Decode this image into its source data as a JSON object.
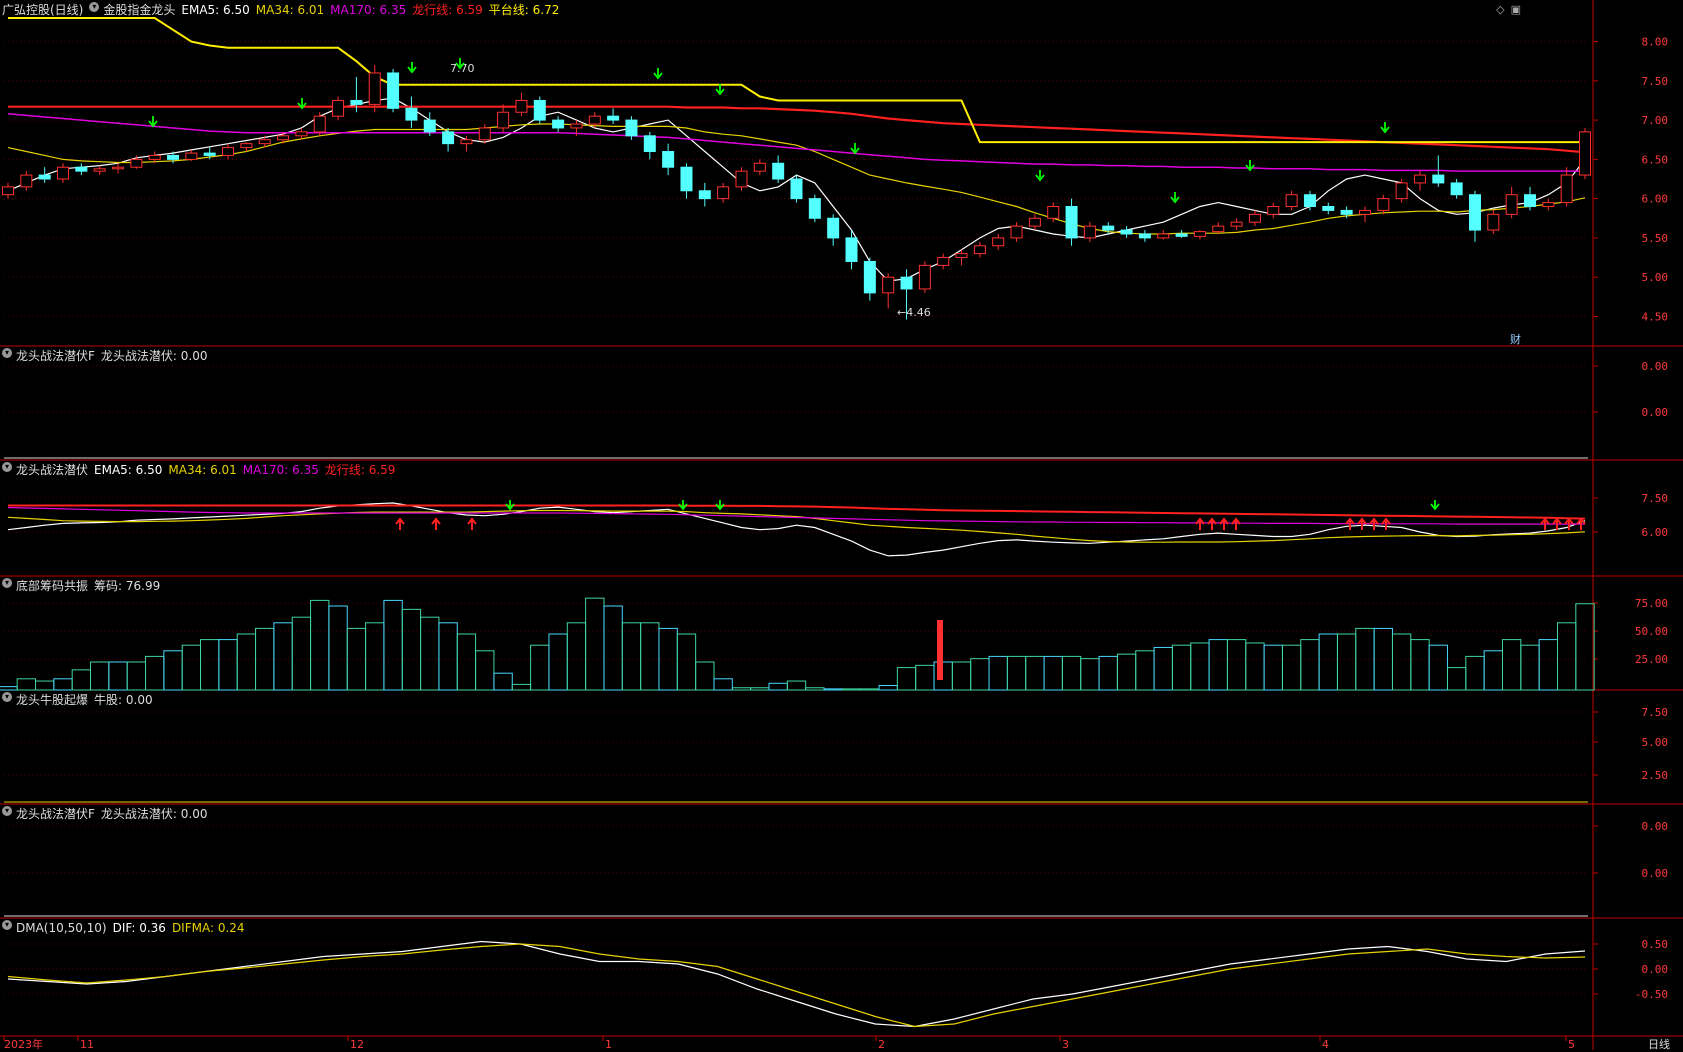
{
  "colors": {
    "ema": "#ffffff",
    "ma34": "#e6d200",
    "ma170": "#e000e0",
    "dragon": "#ff2020",
    "platform": "#ffee00",
    "up": "#ff3030",
    "down": "#54ffff",
    "arrow_down": "#00ff00",
    "arrow_up": "#ff2020",
    "axis": "#c00000"
  },
  "panels": [
    {
      "id": "price",
      "header": [
        {
          "text": "广弘控股(日线)",
          "color": "#dddddd"
        },
        {
          "text": "金股指金龙头",
          "color": "#dddddd",
          "icon": "circle-icon"
        },
        {
          "text": "EMA5: 6.50",
          "color": "#ffffff"
        },
        {
          "text": "MA34: 6.01",
          "color": "#e6d200"
        },
        {
          "text": "MA170: 6.35",
          "color": "#e000e0"
        },
        {
          "text": "龙行线: 6.59",
          "color": "#ff2020"
        },
        {
          "text": "平台线: 6.72",
          "color": "#ffee00"
        }
      ],
      "ticks": [
        "8.00",
        "7.50",
        "7.00",
        "6.50",
        "6.00",
        "5.50",
        "5.00",
        "4.50"
      ]
    },
    {
      "id": "p2",
      "header": [
        {
          "text": "龙头战法潜伏F",
          "color": "#dddddd",
          "icon": "circle-icon"
        },
        {
          "text": "龙头战法潜伏: 0.00",
          "color": "#dddddd"
        }
      ],
      "ticks": [
        "0.00",
        "0.00"
      ]
    },
    {
      "id": "p3",
      "header": [
        {
          "text": "龙头战法潜伏",
          "color": "#dddddd",
          "icon": "circle-icon"
        },
        {
          "text": "EMA5: 6.50",
          "color": "#ffffff"
        },
        {
          "text": "MA34: 6.01",
          "color": "#e6d200"
        },
        {
          "text": "MA170: 6.35",
          "color": "#e000e0"
        },
        {
          "text": "龙行线: 6.59",
          "color": "#ff2020"
        }
      ],
      "ticks": [
        "7.50",
        "6.00"
      ]
    },
    {
      "id": "p4",
      "header": [
        {
          "text": "底部筹码共振",
          "color": "#dddddd",
          "icon": "circle-icon"
        },
        {
          "text": "筹码: 76.99",
          "color": "#dddddd"
        }
      ],
      "ticks": [
        "75.00",
        "50.00",
        "25.00"
      ]
    },
    {
      "id": "p5",
      "header": [
        {
          "text": "龙头牛股起爆",
          "color": "#dddddd",
          "icon": "circle-icon"
        },
        {
          "text": "牛股: 0.00",
          "color": "#dddddd"
        }
      ],
      "ticks": [
        "7.50",
        "5.00",
        "2.50"
      ]
    },
    {
      "id": "p6",
      "header": [
        {
          "text": "龙头战法潜伏F",
          "color": "#dddddd",
          "icon": "circle-icon"
        },
        {
          "text": "龙头战法潜伏: 0.00",
          "color": "#dddddd"
        }
      ],
      "ticks": [
        "0.00",
        "0.00"
      ]
    },
    {
      "id": "p7",
      "header": [
        {
          "text": "DMA(10,50,10)",
          "color": "#dddddd",
          "icon": "circle-icon"
        },
        {
          "text": "DIF: 0.36",
          "color": "#ffffff"
        },
        {
          "text": "DIFMA: 0.24",
          "color": "#e6d200"
        }
      ],
      "ticks": [
        "0.50",
        "0.00",
        "-0.50"
      ]
    }
  ],
  "x_labels": [
    "2023年",
    "11",
    "12",
    "1",
    "2",
    "3",
    "4",
    "5"
  ],
  "annotations": {
    "high": "7.70",
    "low": "4.46",
    "fin_badge": "财",
    "period": "日线"
  },
  "chart_data": {
    "type": "candlestick",
    "ylim": [
      4.2,
      8.3
    ],
    "series": [
      {
        "name": "EMA5",
        "values": [
          6.1,
          6.2,
          6.3,
          6.38,
          6.4,
          6.42,
          6.45,
          6.52,
          6.55,
          6.58,
          6.62,
          6.66,
          6.7,
          6.74,
          6.78,
          6.82,
          6.9,
          7.05,
          7.15,
          7.2,
          7.25,
          7.28,
          7.15,
          7.0,
          6.85,
          6.75,
          6.72,
          6.78,
          6.9,
          7.05,
          7.1,
          7.0,
          6.9,
          6.85,
          6.9,
          6.95,
          7.0,
          6.8,
          6.6,
          6.4,
          6.2,
          6.1,
          6.15,
          6.3,
          6.2,
          5.9,
          5.6,
          5.2,
          4.95,
          4.98,
          5.1,
          5.2,
          5.35,
          5.5,
          5.62,
          5.65,
          5.6,
          5.55,
          5.52,
          5.5,
          5.55,
          5.6,
          5.65,
          5.7,
          5.8,
          5.9,
          5.95,
          5.9,
          5.85,
          5.8,
          5.8,
          5.9,
          6.1,
          6.25,
          6.3,
          6.25,
          6.2,
          6.0,
          5.85,
          5.8,
          5.82,
          5.88,
          5.92,
          5.95,
          6.05,
          6.2,
          6.5
        ]
      },
      {
        "name": "MA34",
        "values": [
          6.65,
          6.6,
          6.55,
          6.5,
          6.48,
          6.47,
          6.46,
          6.46,
          6.47,
          6.48,
          6.5,
          6.53,
          6.56,
          6.6,
          6.66,
          6.72,
          6.76,
          6.8,
          6.83,
          6.86,
          6.88,
          6.88,
          6.88,
          6.88,
          6.88,
          6.88,
          6.9,
          6.92,
          6.94,
          6.95,
          6.95,
          6.94,
          6.93,
          6.92,
          6.92,
          6.92,
          6.92,
          6.9,
          6.85,
          6.82,
          6.8,
          6.76,
          6.72,
          6.68,
          6.6,
          6.5,
          6.4,
          6.3,
          6.25,
          6.2,
          6.16,
          6.12,
          6.08,
          6.02,
          5.96,
          5.9,
          5.82,
          5.75,
          5.68,
          5.62,
          5.58,
          5.56,
          5.55,
          5.55,
          5.56,
          5.56,
          5.56,
          5.57,
          5.6,
          5.62,
          5.66,
          5.7,
          5.75,
          5.78,
          5.8,
          5.82,
          5.83,
          5.84,
          5.84,
          5.83,
          5.85,
          5.86,
          5.88,
          5.9,
          5.93,
          5.96,
          6.01
        ]
      },
      {
        "name": "MA170",
        "values": [
          7.08,
          7.06,
          7.04,
          7.02,
          7.0,
          6.98,
          6.96,
          6.94,
          6.92,
          6.9,
          6.88,
          6.86,
          6.85,
          6.84,
          6.84,
          6.84,
          6.84,
          6.84,
          6.84,
          6.84,
          6.84,
          6.84,
          6.84,
          6.84,
          6.84,
          6.84,
          6.84,
          6.84,
          6.84,
          6.84,
          6.84,
          6.83,
          6.82,
          6.81,
          6.8,
          6.79,
          6.78,
          6.76,
          6.74,
          6.72,
          6.7,
          6.68,
          6.66,
          6.64,
          6.62,
          6.6,
          6.58,
          6.56,
          6.54,
          6.52,
          6.5,
          6.49,
          6.48,
          6.47,
          6.46,
          6.45,
          6.44,
          6.44,
          6.43,
          6.43,
          6.42,
          6.42,
          6.41,
          6.41,
          6.4,
          6.4,
          6.4,
          6.39,
          6.39,
          6.38,
          6.38,
          6.38,
          6.37,
          6.37,
          6.37,
          6.36,
          6.36,
          6.36,
          6.36,
          6.35,
          6.35,
          6.35,
          6.35,
          6.35,
          6.35,
          6.35,
          6.35
        ]
      },
      {
        "name": "龙行线",
        "values": [
          7.17,
          7.17,
          7.17,
          7.17,
          7.17,
          7.17,
          7.17,
          7.17,
          7.17,
          7.17,
          7.17,
          7.17,
          7.17,
          7.17,
          7.17,
          7.17,
          7.17,
          7.17,
          7.17,
          7.17,
          7.17,
          7.17,
          7.17,
          7.17,
          7.17,
          7.17,
          7.17,
          7.17,
          7.17,
          7.17,
          7.17,
          7.17,
          7.17,
          7.17,
          7.17,
          7.17,
          7.17,
          7.16,
          7.16,
          7.16,
          7.15,
          7.15,
          7.14,
          7.13,
          7.12,
          7.1,
          7.08,
          7.05,
          7.02,
          7.0,
          6.98,
          6.96,
          6.95,
          6.94,
          6.93,
          6.92,
          6.91,
          6.9,
          6.89,
          6.88,
          6.87,
          6.86,
          6.85,
          6.84,
          6.83,
          6.82,
          6.81,
          6.8,
          6.79,
          6.78,
          6.77,
          6.76,
          6.75,
          6.74,
          6.73,
          6.72,
          6.71,
          6.7,
          6.69,
          6.68,
          6.67,
          6.66,
          6.65,
          6.64,
          6.63,
          6.61,
          6.59
        ]
      },
      {
        "name": "平台线",
        "values": [
          8.3,
          8.3,
          8.3,
          8.3,
          8.3,
          8.3,
          8.3,
          8.3,
          8.3,
          8.15,
          8.0,
          7.95,
          7.92,
          7.92,
          7.92,
          7.92,
          7.92,
          7.92,
          7.92,
          7.75,
          7.55,
          7.45,
          7.45,
          7.45,
          7.45,
          7.45,
          7.45,
          7.45,
          7.45,
          7.45,
          7.45,
          7.45,
          7.45,
          7.45,
          7.45,
          7.45,
          7.45,
          7.45,
          7.45,
          7.45,
          7.45,
          7.3,
          7.25,
          7.25,
          7.25,
          7.25,
          7.25,
          7.25,
          7.25,
          7.25,
          7.25,
          7.25,
          7.25,
          6.72,
          6.72,
          6.72,
          6.72,
          6.72,
          6.72,
          6.72,
          6.72,
          6.72,
          6.72,
          6.72,
          6.72,
          6.72,
          6.72,
          6.72,
          6.72,
          6.72,
          6.72,
          6.72,
          6.72,
          6.72,
          6.72,
          6.72,
          6.72,
          6.72,
          6.72,
          6.72,
          6.72,
          6.72,
          6.72,
          6.72,
          6.72,
          6.72,
          6.72
        ]
      }
    ],
    "candles": [
      [
        6.05,
        6.2,
        6.0,
        6.15
      ],
      [
        6.15,
        6.35,
        6.1,
        6.3
      ],
      [
        6.3,
        6.4,
        6.2,
        6.25
      ],
      [
        6.25,
        6.45,
        6.2,
        6.4
      ],
      [
        6.4,
        6.45,
        6.3,
        6.35
      ],
      [
        6.35,
        6.42,
        6.3,
        6.38
      ],
      [
        6.38,
        6.45,
        6.32,
        6.4
      ],
      [
        6.4,
        6.55,
        6.38,
        6.5
      ],
      [
        6.5,
        6.6,
        6.45,
        6.55
      ],
      [
        6.55,
        6.6,
        6.45,
        6.5
      ],
      [
        6.5,
        6.62,
        6.48,
        6.58
      ],
      [
        6.58,
        6.65,
        6.5,
        6.55
      ],
      [
        6.55,
        6.7,
        6.5,
        6.65
      ],
      [
        6.65,
        6.72,
        6.6,
        6.7
      ],
      [
        6.7,
        6.8,
        6.65,
        6.75
      ],
      [
        6.75,
        6.85,
        6.7,
        6.8
      ],
      [
        6.8,
        6.9,
        6.75,
        6.85
      ],
      [
        6.85,
        7.1,
        6.8,
        7.05
      ],
      [
        7.05,
        7.3,
        7.0,
        7.25
      ],
      [
        7.25,
        7.55,
        7.1,
        7.2
      ],
      [
        7.2,
        7.7,
        7.1,
        7.6
      ],
      [
        7.6,
        7.65,
        7.1,
        7.15
      ],
      [
        7.15,
        7.3,
        6.9,
        7.0
      ],
      [
        7.0,
        7.1,
        6.8,
        6.85
      ],
      [
        6.85,
        6.9,
        6.6,
        6.7
      ],
      [
        6.7,
        6.8,
        6.6,
        6.75
      ],
      [
        6.75,
        6.95,
        6.7,
        6.9
      ],
      [
        6.9,
        7.2,
        6.85,
        7.1
      ],
      [
        7.1,
        7.35,
        7.05,
        7.25
      ],
      [
        7.25,
        7.3,
        6.95,
        7.0
      ],
      [
        7.0,
        7.05,
        6.85,
        6.9
      ],
      [
        6.9,
        7.0,
        6.8,
        6.95
      ],
      [
        6.95,
        7.1,
        6.9,
        7.05
      ],
      [
        7.05,
        7.15,
        6.95,
        7.0
      ],
      [
        7.0,
        7.05,
        6.75,
        6.8
      ],
      [
        6.8,
        6.85,
        6.5,
        6.6
      ],
      [
        6.6,
        6.7,
        6.3,
        6.4
      ],
      [
        6.4,
        6.45,
        6.0,
        6.1
      ],
      [
        6.1,
        6.2,
        5.9,
        6.0
      ],
      [
        6.0,
        6.2,
        5.95,
        6.15
      ],
      [
        6.15,
        6.4,
        6.1,
        6.35
      ],
      [
        6.35,
        6.5,
        6.3,
        6.45
      ],
      [
        6.45,
        6.55,
        6.2,
        6.25
      ],
      [
        6.25,
        6.3,
        5.95,
        6.0
      ],
      [
        6.0,
        6.05,
        5.7,
        5.75
      ],
      [
        5.75,
        5.8,
        5.4,
        5.5
      ],
      [
        5.5,
        5.6,
        5.1,
        5.2
      ],
      [
        5.2,
        5.25,
        4.7,
        4.8
      ],
      [
        4.8,
        5.05,
        4.6,
        5.0
      ],
      [
        5.0,
        5.1,
        4.46,
        4.85
      ],
      [
        4.85,
        5.2,
        4.8,
        5.15
      ],
      [
        5.15,
        5.3,
        5.1,
        5.25
      ],
      [
        5.25,
        5.35,
        5.15,
        5.3
      ],
      [
        5.3,
        5.45,
        5.25,
        5.4
      ],
      [
        5.4,
        5.55,
        5.35,
        5.5
      ],
      [
        5.5,
        5.7,
        5.45,
        5.65
      ],
      [
        5.65,
        5.8,
        5.6,
        5.75
      ],
      [
        5.75,
        5.95,
        5.7,
        5.9
      ],
      [
        5.9,
        6.0,
        5.4,
        5.5
      ],
      [
        5.5,
        5.7,
        5.45,
        5.65
      ],
      [
        5.65,
        5.7,
        5.55,
        5.6
      ],
      [
        5.6,
        5.65,
        5.5,
        5.55
      ],
      [
        5.55,
        5.6,
        5.45,
        5.5
      ],
      [
        5.5,
        5.6,
        5.48,
        5.55
      ],
      [
        5.55,
        5.6,
        5.5,
        5.52
      ],
      [
        5.52,
        5.6,
        5.48,
        5.58
      ],
      [
        5.58,
        5.7,
        5.55,
        5.65
      ],
      [
        5.65,
        5.75,
        5.6,
        5.7
      ],
      [
        5.7,
        5.85,
        5.65,
        5.8
      ],
      [
        5.8,
        5.95,
        5.75,
        5.9
      ],
      [
        5.9,
        6.1,
        5.85,
        6.05
      ],
      [
        6.05,
        6.1,
        5.85,
        5.9
      ],
      [
        5.9,
        5.95,
        5.8,
        5.85
      ],
      [
        5.85,
        5.9,
        5.75,
        5.8
      ],
      [
        5.8,
        5.9,
        5.7,
        5.85
      ],
      [
        5.85,
        6.05,
        5.8,
        6.0
      ],
      [
        6.0,
        6.25,
        5.95,
        6.2
      ],
      [
        6.2,
        6.35,
        6.1,
        6.3
      ],
      [
        6.3,
        6.55,
        6.15,
        6.2
      ],
      [
        6.2,
        6.25,
        6.0,
        6.05
      ],
      [
        6.05,
        6.1,
        5.45,
        5.6
      ],
      [
        5.6,
        5.85,
        5.55,
        5.8
      ],
      [
        5.8,
        6.15,
        5.75,
        6.05
      ],
      [
        6.05,
        6.15,
        5.85,
        5.9
      ],
      [
        5.9,
        6.0,
        5.85,
        5.95
      ],
      [
        5.95,
        6.4,
        5.9,
        6.3
      ],
      [
        6.3,
        6.9,
        6.25,
        6.85
      ]
    ]
  }
}
